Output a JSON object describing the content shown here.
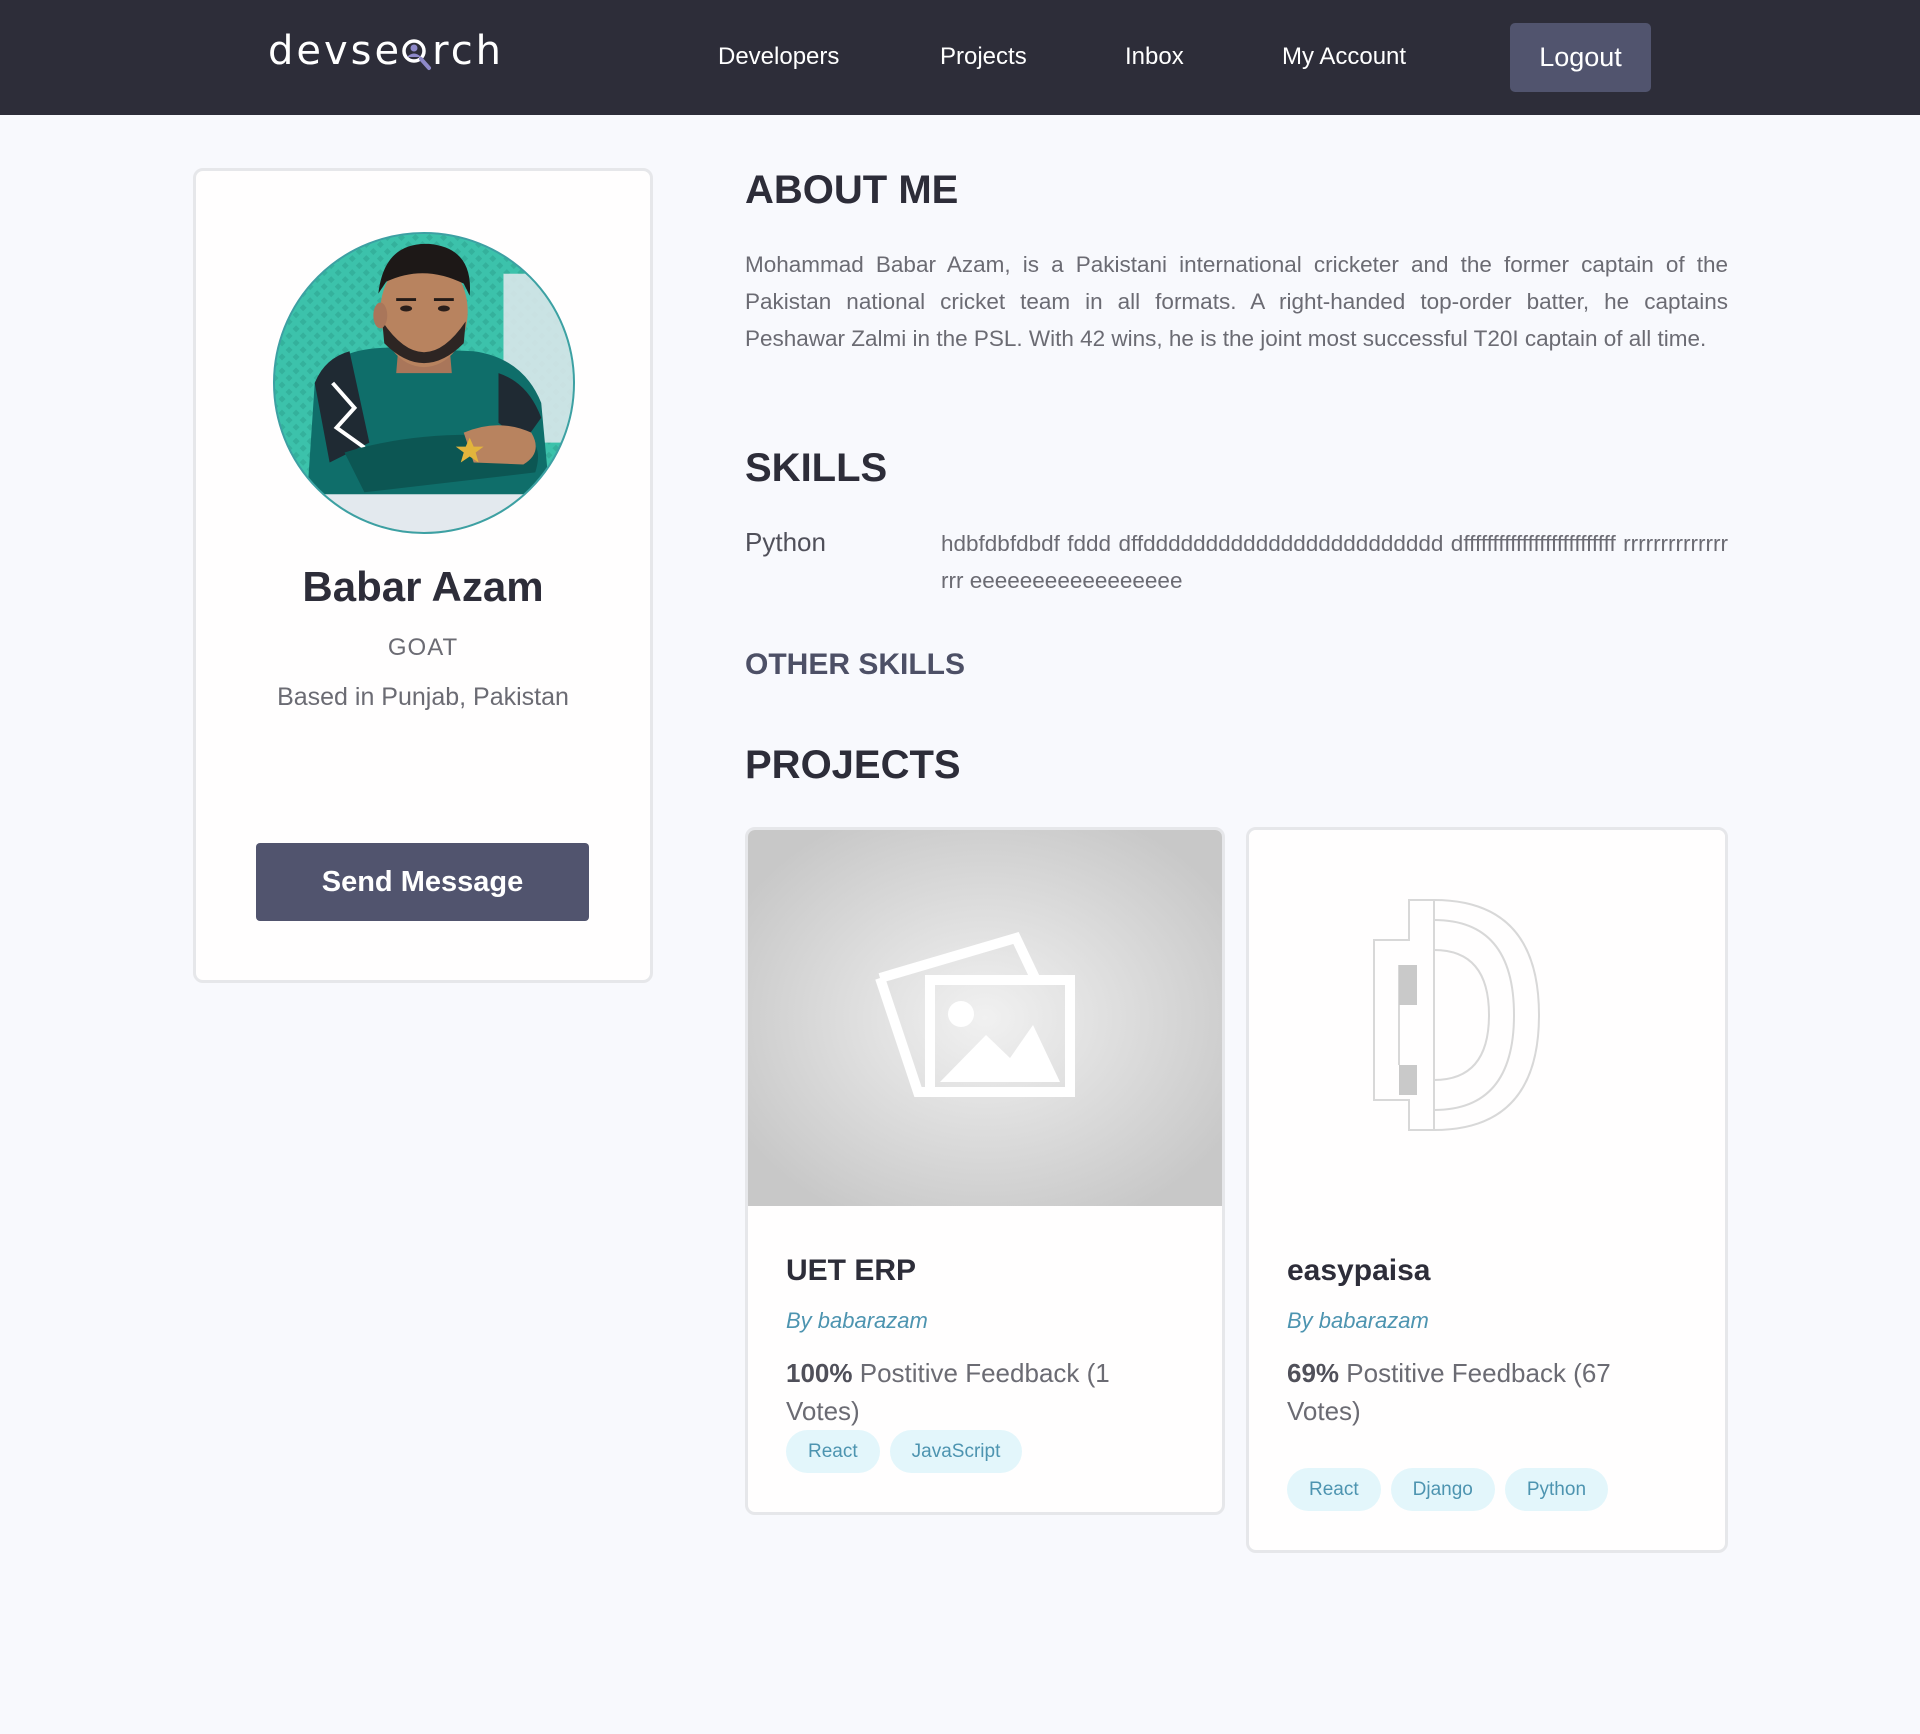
{
  "header": {
    "logo": "devsearch",
    "logo_before": "devse",
    "logo_after": "rch",
    "nav": [
      "Developers",
      "Projects",
      "Inbox",
      "My Account"
    ],
    "logout_label": "Logout"
  },
  "profile": {
    "name": "Babar Azam",
    "title": "GOAT",
    "location": "Based in Punjab, Pakistan",
    "send_message_label": "Send Message"
  },
  "about": {
    "heading": "ABOUT ME",
    "text": "Mohammad Babar Azam, is a Pakistani international cricketer and the former captain of the Pakistan national cricket team in all formats. A right-handed top-order batter, he captains Peshawar Zalmi in the PSL. With 42 wins, he is the joint most successful T20I captain of all time."
  },
  "skills": {
    "heading": "SKILLS",
    "items": [
      {
        "name": "Python",
        "description": "hdbfdbfdbdf fddd dffdddddddddddddddddddddddd dffffffffffffffffffffffffff rrrrrrrrrrrrrrrrr eeeeeeeeeeeeeeeee"
      }
    ],
    "other_heading": "OTHER SKILLS"
  },
  "projects": {
    "heading": "PROJECTS",
    "items": [
      {
        "title": "UET ERP",
        "author": "By babarazam",
        "feedback_percent": "100%",
        "feedback_text": "Postitive Feedback (1 Votes)",
        "tags": [
          "React",
          "JavaScript"
        ],
        "thumbnail_icon": "image-placeholder-icon"
      },
      {
        "title": "easypaisa",
        "author": "By babarazam",
        "feedback_percent": "69%",
        "feedback_text": "Postitive Feedback (67 Votes)",
        "tags": [
          "React",
          "Django",
          "Python"
        ],
        "thumbnail_icon": "d-logo-icon"
      }
    ]
  },
  "colors": {
    "header_bg": "#2d2d39",
    "button_bg": "#51546e",
    "tag_bg": "#e3f6fb",
    "link": "#4d94b0",
    "page_bg": "#f8f9fd"
  }
}
